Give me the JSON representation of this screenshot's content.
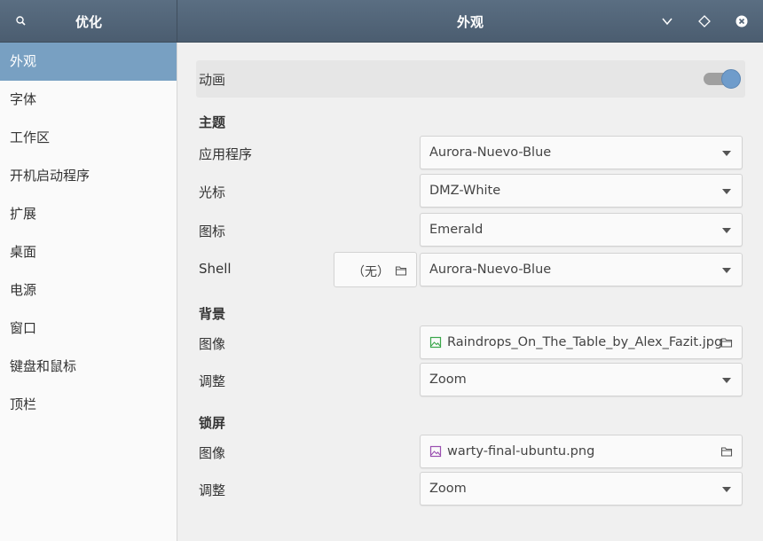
{
  "header": {
    "left_title": "优化",
    "main_title": "外观",
    "search_icon": "search-icon",
    "menu_icon": "chevron-down-icon",
    "restore_icon": "diamond-icon",
    "close_icon": "close-icon"
  },
  "sidebar": {
    "items": [
      {
        "label": "外观",
        "active": true
      },
      {
        "label": "字体"
      },
      {
        "label": "工作区"
      },
      {
        "label": "开机启动程序"
      },
      {
        "label": "扩展"
      },
      {
        "label": "桌面"
      },
      {
        "label": "电源"
      },
      {
        "label": "窗口"
      },
      {
        "label": "键盘和鼠标"
      },
      {
        "label": "顶栏"
      }
    ]
  },
  "main": {
    "animation": {
      "label": "动画",
      "enabled": true
    },
    "themes": {
      "section": "主题",
      "applications": {
        "label": "应用程序",
        "value": "Aurora-Nuevo-Blue"
      },
      "cursor": {
        "label": "光标",
        "value": "DMZ-White"
      },
      "icons": {
        "label": "图标",
        "value": "Emerald"
      },
      "shell": {
        "label": "Shell",
        "none_label": "（无）",
        "value": "Aurora-Nuevo-Blue"
      }
    },
    "background": {
      "section": "背景",
      "image": {
        "label": "图像",
        "value": "Raindrops_On_The_Table_by_Alex_Fazit.jpg"
      },
      "adjust": {
        "label": "调整",
        "value": "Zoom"
      }
    },
    "lockscreen": {
      "section": "锁屏",
      "image": {
        "label": "图像",
        "value": "warty-final-ubuntu.png"
      },
      "adjust": {
        "label": "调整",
        "value": "Zoom"
      }
    }
  },
  "colors": {
    "header_bg": "#4f6275",
    "sidebar_active": "#78a0c2",
    "toggle_on": "#6f9ccb"
  }
}
